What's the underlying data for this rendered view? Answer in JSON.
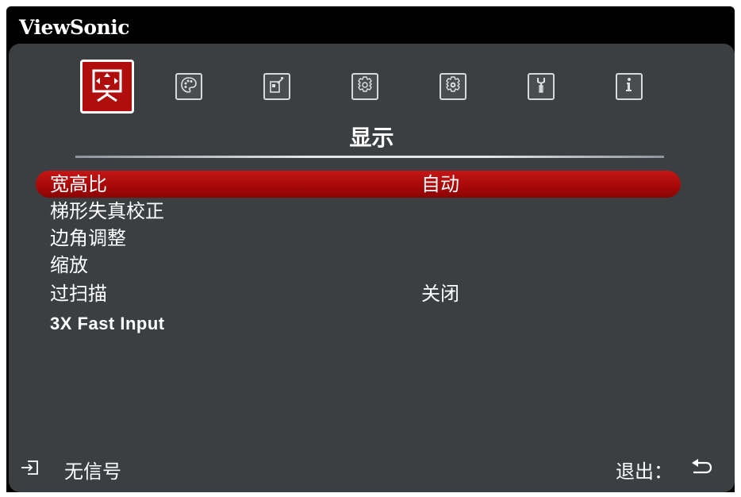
{
  "brand": "ViewSonic",
  "tabs": [
    {
      "icon": "display-icon",
      "active": true
    },
    {
      "icon": "picture-palette-icon",
      "active": false
    },
    {
      "icon": "power-management-icon",
      "active": false
    },
    {
      "icon": "basic-settings-gear-icon",
      "active": false
    },
    {
      "icon": "advanced-settings-gear-icon",
      "active": false
    },
    {
      "icon": "wrench-tools-icon",
      "active": false
    },
    {
      "icon": "information-icon",
      "active": false
    }
  ],
  "section_title": "显示",
  "menu": [
    {
      "label": "宽高比",
      "value": "自动",
      "selected": true
    },
    {
      "label": "梯形失真校正",
      "value": ""
    },
    {
      "label": "边角调整",
      "value": ""
    },
    {
      "label": "缩放",
      "value": ""
    },
    {
      "label": "过扫描",
      "value": "关闭"
    },
    {
      "label": "3X Fast Input",
      "value": ""
    }
  ],
  "footer": {
    "source_status": "无信号",
    "exit_label": "退出："
  },
  "colors": {
    "panel": "#3c3f41",
    "selection": "#b00d0d",
    "frame": "#000000"
  }
}
